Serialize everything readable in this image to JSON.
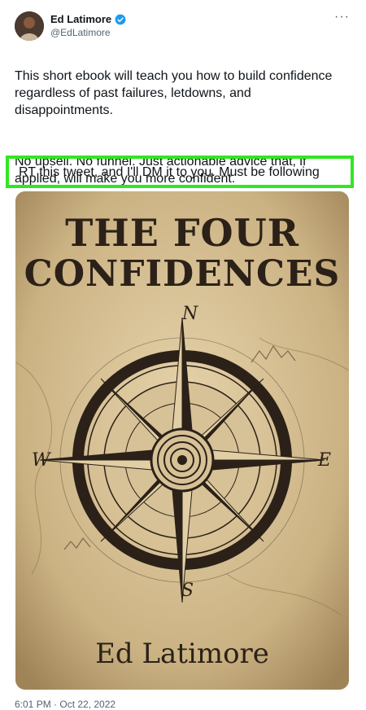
{
  "author": {
    "display_name": "Ed Latimore",
    "handle": "@EdLatimore",
    "verified": true,
    "verified_color": "#1d9bf0"
  },
  "menu": {
    "more_label": "···"
  },
  "tweet": {
    "paragraph1": "This short ebook will teach you how to build confidence regardless of past failures, letdowns, and disappointments.",
    "paragraph2": "No upsell. No funnel. Just actionable advice that, if applied, will make you more confident.",
    "highlight_text": "RT this tweet, and I'll DM it to you. Must be following",
    "highlight_color": "#31e622"
  },
  "media": {
    "title_line1": "THE FOUR",
    "title_line2": "CONFIDENCES",
    "author": "Ed Latimore",
    "compass": {
      "north": "N",
      "south": "S",
      "east": "E",
      "west": "W"
    }
  },
  "footer": {
    "timestamp": "6:01 PM · Oct 22, 2022"
  }
}
